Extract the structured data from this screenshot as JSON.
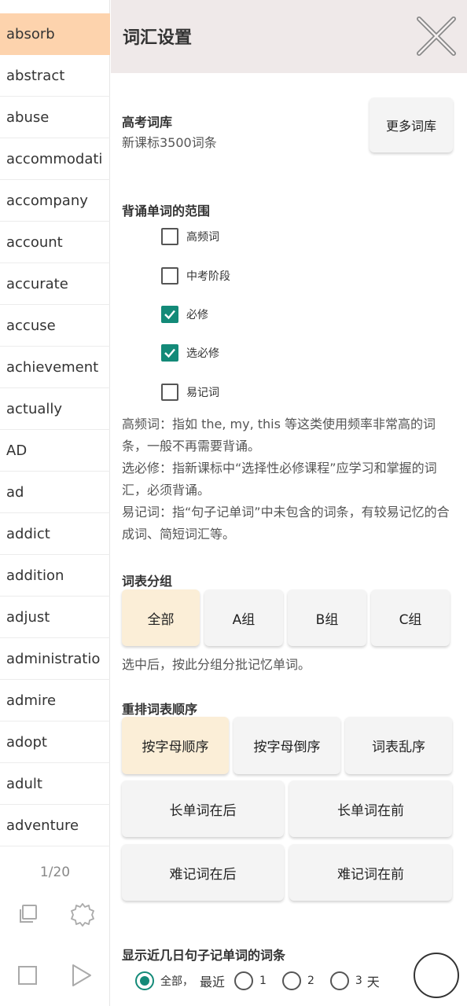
{
  "sidebar": {
    "words": [
      "absorb",
      "abstract",
      "abuse",
      "accommodati",
      "accompany",
      "account",
      "accurate",
      "accuse",
      "achievement",
      "actually",
      "AD",
      "ad",
      "addict",
      "addition",
      "adjust",
      "administratio",
      "admire",
      "adopt",
      "adult",
      "adventure"
    ],
    "page_indicator": "1/20"
  },
  "header": {
    "title": "词汇设置"
  },
  "library": {
    "name": "高考词库",
    "subtitle": "新课标3500词条",
    "more_button": "更多词库"
  },
  "scope": {
    "title": "背诵单词的范围",
    "options": [
      {
        "label": "高频词",
        "checked": false
      },
      {
        "label": "中考阶段",
        "checked": false
      },
      {
        "label": "必修",
        "checked": true
      },
      {
        "label": "选必修",
        "checked": true
      },
      {
        "label": "易记词",
        "checked": false
      }
    ],
    "descriptions": [
      "高频词：指如 the, my, this 等这类使用频率非常高的词条，一般不再需要背诵。",
      "选必修：指新课标中“选择性必修课程”应学习和掌握的词汇，必须背诵。",
      "易记词：指“句子记单词”中未包含的词条，有较易记忆的合成词、简短词汇等。"
    ]
  },
  "grouping": {
    "title": "词表分组",
    "buttons": [
      "全部",
      "A组",
      "B组",
      "C组"
    ],
    "hint": "选中后，按此分组分批记忆单词。"
  },
  "ordering": {
    "title": "重排词表顺序",
    "row1": [
      "按字母顺序",
      "按字母倒序",
      "词表乱序"
    ],
    "row2": [
      "长单词在后",
      "长单词在前"
    ],
    "row3": [
      "难记词在后",
      "难记词在前"
    ]
  },
  "recent": {
    "title": "显示近几日句子记单词的词条",
    "all_label": "全部，",
    "recent_label": "最近",
    "options": [
      "1",
      "2"
    ],
    "days_value": "3",
    "days_unit": "天"
  },
  "colors": {
    "accent": "#138a78",
    "selected_word": "#fdd3ad",
    "active_button": "#fbeed7",
    "header_bg": "#efe9e9"
  }
}
